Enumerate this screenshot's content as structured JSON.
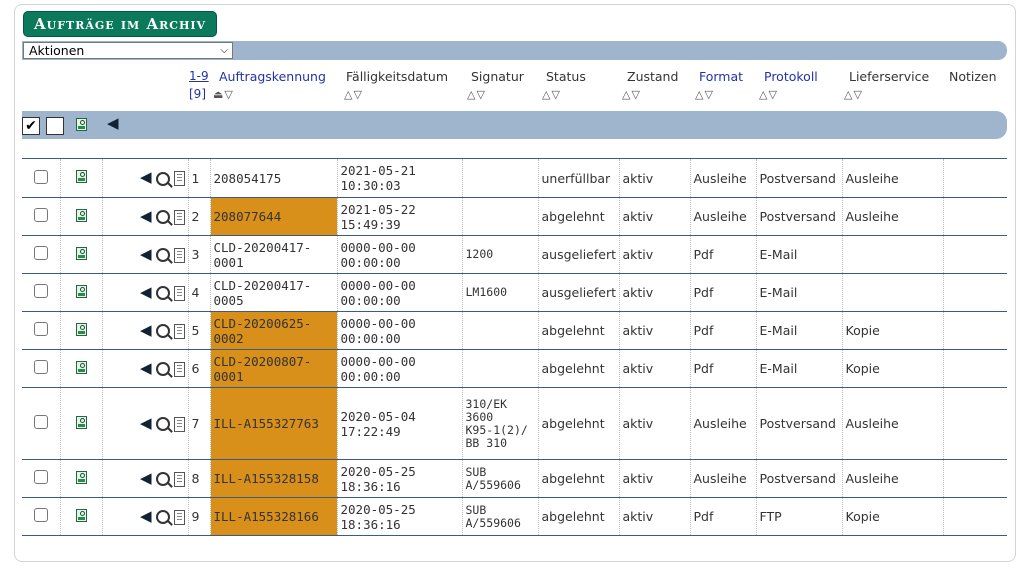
{
  "title": "Aufträge im Archiv",
  "actions_select": "Aktionen",
  "range": "1-9",
  "count": "[9]",
  "columns": [
    {
      "label": "Auftragskennung",
      "blue": true
    },
    {
      "label": "Fälligkeitsdatum",
      "blue": false
    },
    {
      "label": "Signatur",
      "blue": false
    },
    {
      "label": "Status",
      "blue": false
    },
    {
      "label": "Zustand",
      "blue": false
    },
    {
      "label": "Format",
      "blue": true
    },
    {
      "label": "Protokoll",
      "blue": true
    },
    {
      "label": "Lieferservice",
      "blue": false
    },
    {
      "label": "Notizen",
      "blue": false
    }
  ],
  "sort_glyph": "△▽",
  "sort_glyph_active": "⏏▽",
  "check_all_glyph": "✔",
  "icons": {
    "user": "user-card-icon",
    "arrow": "back-arrow-icon",
    "search": "magnifier-icon",
    "doc": "document-icon"
  },
  "arrow_glyph": "◀",
  "accent_orange": "#d8901a",
  "rows": [
    {
      "n": "1",
      "id": "208054175",
      "orange": false,
      "date": "2021-05-21",
      "time": "10:30:03",
      "sig": [],
      "status": "unerfüllbar",
      "zustand": "aktiv",
      "format": "Ausleihe",
      "protokoll": "Postversand",
      "liefer": "Ausleihe"
    },
    {
      "n": "2",
      "id": "208077644",
      "orange": true,
      "date": "2021-05-22",
      "time": "15:49:39",
      "sig": [],
      "status": "abgelehnt",
      "zustand": "aktiv",
      "format": "Ausleihe",
      "protokoll": "Postversand",
      "liefer": "Ausleihe"
    },
    {
      "n": "3",
      "id": "CLD-20200417-0001",
      "orange": false,
      "date": "0000-00-00",
      "time": "00:00:00",
      "sig": [
        "1200"
      ],
      "status": "ausgeliefert",
      "zustand": "aktiv",
      "format": "Pdf",
      "protokoll": "E-Mail",
      "liefer": ""
    },
    {
      "n": "4",
      "id": "CLD-20200417-0005",
      "orange": false,
      "date": "0000-00-00",
      "time": "00:00:00",
      "sig": [
        "LM1600"
      ],
      "status": "ausgeliefert",
      "zustand": "aktiv",
      "format": "Pdf",
      "protokoll": "E-Mail",
      "liefer": ""
    },
    {
      "n": "5",
      "id": "CLD-20200625-0002",
      "orange": true,
      "date": "0000-00-00",
      "time": "00:00:00",
      "sig": [],
      "status": "abgelehnt",
      "zustand": "aktiv",
      "format": "Pdf",
      "protokoll": "E-Mail",
      "liefer": "Kopie"
    },
    {
      "n": "6",
      "id": "CLD-20200807-0001",
      "orange": true,
      "date": "0000-00-00",
      "time": "00:00:00",
      "sig": [],
      "status": "abgelehnt",
      "zustand": "aktiv",
      "format": "Pdf",
      "protokoll": "E-Mail",
      "liefer": "Kopie"
    },
    {
      "n": "7",
      "id": "ILL-A155327763",
      "orange": true,
      "date": "2020-05-04",
      "time": "17:22:49",
      "sig": [
        "310/EK",
        "3600",
        "K95-1(2)/",
        "BB 310"
      ],
      "status": "abgelehnt",
      "zustand": "aktiv",
      "format": "Ausleihe",
      "protokoll": "Postversand",
      "liefer": "Ausleihe"
    },
    {
      "n": "8",
      "id": "ILL-A155328158",
      "orange": true,
      "date": "2020-05-25",
      "time": "18:36:16",
      "sig": [
        "SUB",
        "A/559606"
      ],
      "status": "abgelehnt",
      "zustand": "aktiv",
      "format": "Ausleihe",
      "protokoll": "Postversand",
      "liefer": "Ausleihe"
    },
    {
      "n": "9",
      "id": "ILL-A155328166",
      "orange": true,
      "date": "2020-05-25",
      "time": "18:36:16",
      "sig": [
        "SUB",
        "A/559606"
      ],
      "status": "abgelehnt",
      "zustand": "aktiv",
      "format": "Pdf",
      "protokoll": "FTP",
      "liefer": "Kopie"
    }
  ]
}
